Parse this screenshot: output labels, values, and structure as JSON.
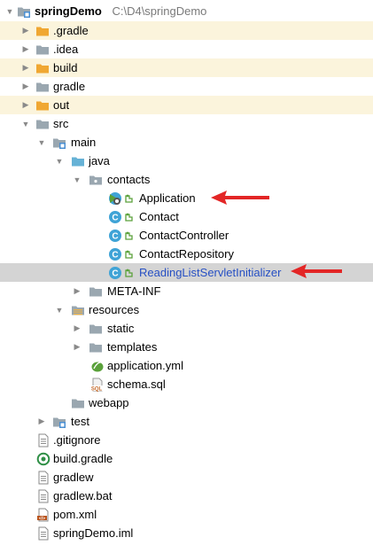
{
  "project": {
    "name": "springDemo",
    "path": "C:\\D4\\springDemo"
  },
  "tree": {
    "gradle_dir": ".gradle",
    "idea_dir": ".idea",
    "build_dir": "build",
    "gradle_folder": "gradle",
    "out_dir": "out",
    "src_dir": "src",
    "main_dir": "main",
    "java_dir": "java",
    "contacts_pkg": "contacts",
    "application_class": "Application",
    "contact_class": "Contact",
    "controller_class": "ContactController",
    "repository_class": "ContactRepository",
    "initializer_class": "ReadingListServletInitializer",
    "metainf_dir": "META-INF",
    "resources_dir": "resources",
    "static_dir": "static",
    "templates_dir": "templates",
    "app_yml": "application.yml",
    "schema_sql": "schema.sql",
    "webapp_dir": "webapp",
    "test_dir": "test",
    "gitignore_file": ".gitignore",
    "build_gradle_file": "build.gradle",
    "gradlew_file": "gradlew",
    "gradlew_bat_file": "gradlew.bat",
    "pom_file": "pom.xml",
    "iml_file": "springDemo.iml"
  },
  "colors": {
    "folder": "#9aa7b0",
    "excluded_folder": "#f0a732",
    "source_folder": "#66b2d6",
    "resource_folder": "#9aa7b0",
    "class_badge": "#3fa3d6",
    "spring_green": "#5aa13a",
    "annotation_arrow": "#e32626",
    "selected_row": "#d4d4d4",
    "excluded_row": "#fbf4dc"
  },
  "icons": {
    "folder": "folder-icon",
    "module_folder": "module-folder-icon",
    "source_folder": "source-folder-icon",
    "resource_folder": "resource-folder-icon",
    "package": "package-icon",
    "spring_boot_class": "spring-boot-class-icon",
    "java_class": "java-class-icon",
    "spring_bean": "spring-bean-badge-icon",
    "yaml": "spring-yaml-icon",
    "sql": "sql-file-icon",
    "text_file": "text-file-icon",
    "gradle_file": "gradle-file-icon",
    "maven_file": "maven-file-icon",
    "arrow_right": "chevron-right-icon",
    "arrow_down": "chevron-down-icon"
  }
}
